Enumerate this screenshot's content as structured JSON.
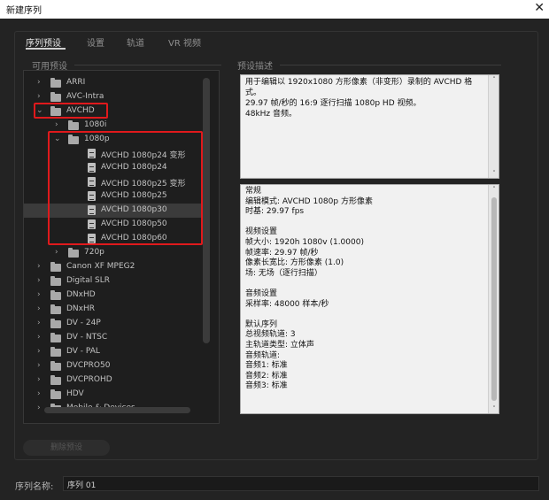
{
  "window": {
    "title": "新建序列",
    "close_glyph": "✕"
  },
  "tabs": [
    {
      "label": "序列预设",
      "active": true
    },
    {
      "label": "设置",
      "active": false
    },
    {
      "label": "轨道",
      "active": false
    },
    {
      "label": "VR 视频",
      "active": false
    }
  ],
  "available_presets": {
    "label": "可用预设",
    "items": [
      {
        "label": "ARRI",
        "kind": "folder",
        "level": 0,
        "expanded": false
      },
      {
        "label": "AVC-Intra",
        "kind": "folder",
        "level": 0,
        "expanded": false
      },
      {
        "label": "AVCHD",
        "kind": "folder",
        "level": 0,
        "expanded": true
      },
      {
        "label": "1080i",
        "kind": "folder",
        "level": 1,
        "expanded": false
      },
      {
        "label": "1080p",
        "kind": "folder",
        "level": 1,
        "expanded": true
      },
      {
        "label": "AVCHD  1080p24 变形",
        "kind": "preset",
        "level": 2
      },
      {
        "label": "AVCHD 1080p24",
        "kind": "preset",
        "level": 2
      },
      {
        "label": "AVCHD  1080p25 变形",
        "kind": "preset",
        "level": 2
      },
      {
        "label": "AVCHD 1080p25",
        "kind": "preset",
        "level": 2
      },
      {
        "label": "AVCHD 1080p30",
        "kind": "preset",
        "level": 2,
        "selected": true
      },
      {
        "label": "AVCHD 1080p50",
        "kind": "preset",
        "level": 2
      },
      {
        "label": "AVCHD 1080p60",
        "kind": "preset",
        "level": 2
      },
      {
        "label": "720p",
        "kind": "folder",
        "level": 1,
        "expanded": false
      },
      {
        "label": "Canon XF MPEG2",
        "kind": "folder",
        "level": 0,
        "expanded": false
      },
      {
        "label": "Digital SLR",
        "kind": "folder",
        "level": 0,
        "expanded": false
      },
      {
        "label": "DNxHD",
        "kind": "folder",
        "level": 0,
        "expanded": false
      },
      {
        "label": "DNxHR",
        "kind": "folder",
        "level": 0,
        "expanded": false
      },
      {
        "label": "DV - 24P",
        "kind": "folder",
        "level": 0,
        "expanded": false
      },
      {
        "label": "DV - NTSC",
        "kind": "folder",
        "level": 0,
        "expanded": false
      },
      {
        "label": "DV - PAL",
        "kind": "folder",
        "level": 0,
        "expanded": false
      },
      {
        "label": "DVCPRO50",
        "kind": "folder",
        "level": 0,
        "expanded": false
      },
      {
        "label": "DVCPROHD",
        "kind": "folder",
        "level": 0,
        "expanded": false
      },
      {
        "label": "HDV",
        "kind": "folder",
        "level": 0,
        "expanded": false
      },
      {
        "label": "Mobile & Devices",
        "kind": "folder",
        "level": 0,
        "expanded": false
      }
    ]
  },
  "description": {
    "label": "预设描述",
    "text_lines": [
      "用于编辑以 1920x1080 方形像素（非变形）录制的 AVCHD 格",
      "式。",
      "29.97 帧/秒的 16:9 逐行扫描 1080p HD 视频。",
      "48kHz 音频。"
    ]
  },
  "info": {
    "lines": [
      "常规",
      " 编辑模式: AVCHD 1080p 方形像素",
      " 时基: 29.97 fps",
      "",
      "视频设置",
      " 帧大小: 1920h 1080v (1.0000)",
      " 帧速率: 29.97 帧/秒",
      " 像素长宽比: 方形像素 (1.0)",
      " 场: 无场（逐行扫描）",
      "",
      "音频设置",
      " 采样率: 48000 样本/秒",
      "",
      "默认序列",
      " 总视频轨道: 3",
      " 主轨道类型: 立体声",
      " 音频轨道:",
      " 音频1: 标准",
      " 音频2: 标准",
      " 音频3: 标准"
    ]
  },
  "delete_button": {
    "label": "删除预设"
  },
  "sequence_name": {
    "label": "序列名称:",
    "value": "序列 01"
  },
  "colors": {
    "highlight_outline": "#e0191c",
    "background": "#232323"
  },
  "icons": [
    "close-icon",
    "chevron-right-icon",
    "chevron-down-icon",
    "folder-icon",
    "preset-file-icon",
    "scroll-up-icon",
    "scroll-down-icon"
  ]
}
